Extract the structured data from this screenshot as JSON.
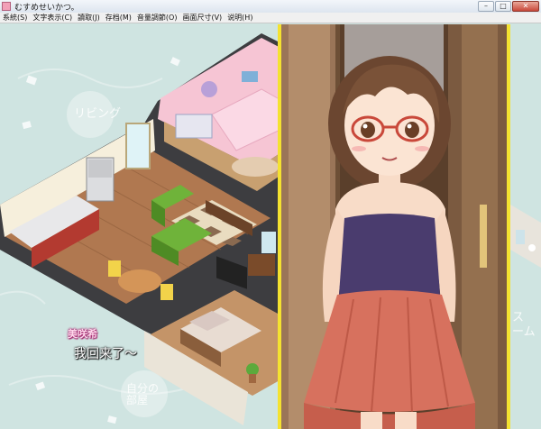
{
  "window": {
    "title": "むすめせいかつ。",
    "buttons": {
      "minimize": "–",
      "maximize": "□",
      "close": "✕"
    }
  },
  "menu": [
    {
      "label": "系統(S)"
    },
    {
      "label": "文字表示(C)"
    },
    {
      "label": "讀取(J)"
    },
    {
      "label": "存档(M)"
    },
    {
      "label": "音量調節(O)"
    },
    {
      "label": "画面尺寸(V)"
    },
    {
      "label": "说明(H)"
    }
  ],
  "rooms": {
    "living": "リビング",
    "own_room": "自分の\n部屋",
    "system_room": "ス\nーム"
  },
  "dialogue": {
    "speaker": "美咲希",
    "text": "我回来了～"
  },
  "colors": {
    "panel_border": "#f4e230",
    "floor": "#b07850",
    "wall": "#f7f1e2",
    "bedroom_wall": "#f4c6d6"
  }
}
